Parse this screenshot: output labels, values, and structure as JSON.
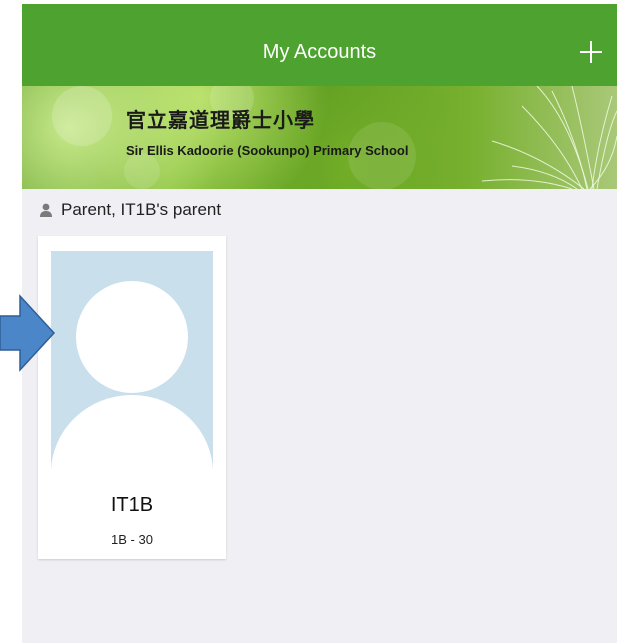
{
  "header": {
    "title": "My Accounts",
    "add_icon": "plus-icon",
    "bg_color": "#4ea22f"
  },
  "school": {
    "name_cn": "官立嘉道理爵士小學",
    "name_en": "Sir Ellis Kadoorie (Sookunpo) Primary School"
  },
  "account": {
    "role_icon": "person-icon",
    "role_label": "Parent, IT1B's parent"
  },
  "students": [
    {
      "name": "IT1B",
      "class_no": "1B - 30",
      "avatar": "default-avatar-icon"
    }
  ],
  "annotation": {
    "arrow_icon": "arrow-right-icon",
    "arrow_color": "#4a86c8"
  }
}
